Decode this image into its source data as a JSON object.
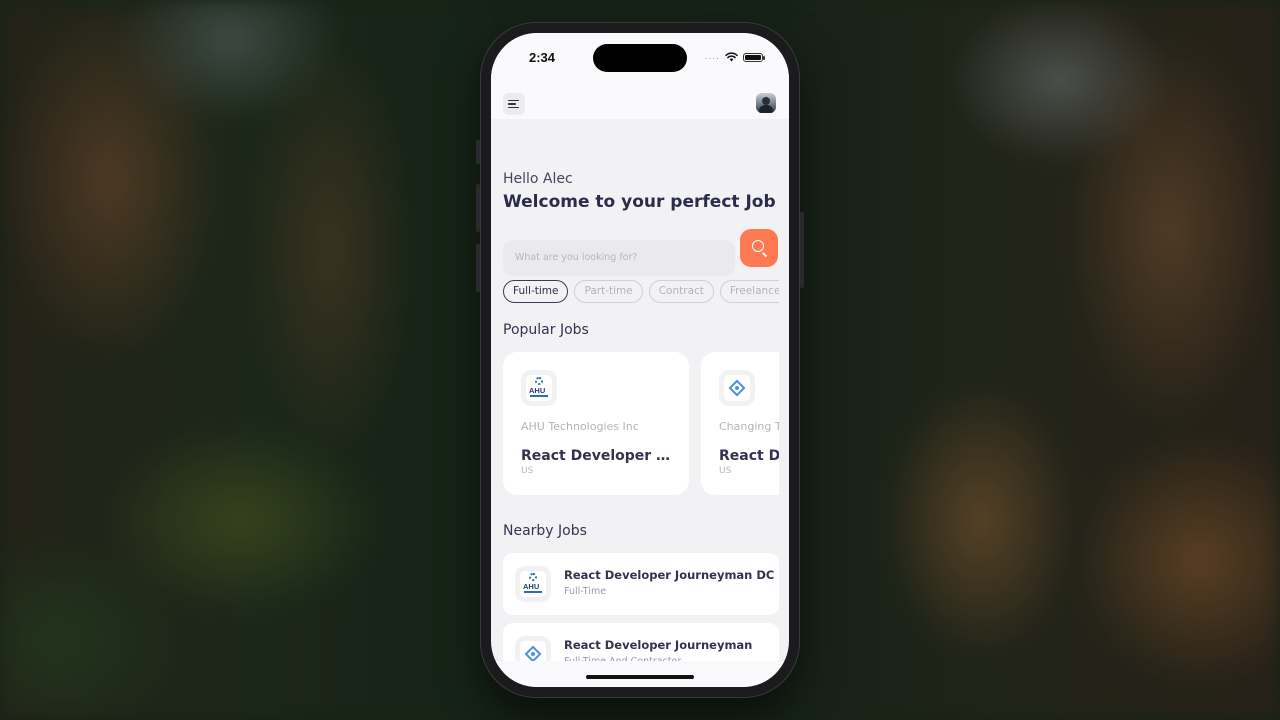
{
  "status_bar": {
    "time": "2:34",
    "signal": "...."
  },
  "header": {
    "menu_icon": "menu-icon",
    "avatar": "user-avatar"
  },
  "greeting": "Hello Alec",
  "welcome": "Welcome to your perfect Job",
  "search": {
    "placeholder": "What are you looking for?",
    "button_icon": "search-icon",
    "accent": "#fe7a52"
  },
  "filters": [
    {
      "label": "Full-time",
      "active": true
    },
    {
      "label": "Part-time",
      "active": false
    },
    {
      "label": "Contract",
      "active": false
    },
    {
      "label": "Freelance",
      "active": false
    }
  ],
  "popular": {
    "title": "Popular Jobs",
    "jobs": [
      {
        "company": "AHU Technologies Inc",
        "title": "React Developer Journeyman DC",
        "location": "US",
        "logo_text": "AHU"
      },
      {
        "company": "Changing The Present",
        "title": "React Developer Journeyman",
        "location": "US"
      }
    ]
  },
  "nearby": {
    "title": "Nearby Jobs",
    "jobs": [
      {
        "title": "React Developer Journeyman DC",
        "type": "Full-Time",
        "logo_text": "AHU"
      },
      {
        "title": "React Developer Journeyman",
        "type": "Full-Time And Contractor"
      }
    ]
  }
}
